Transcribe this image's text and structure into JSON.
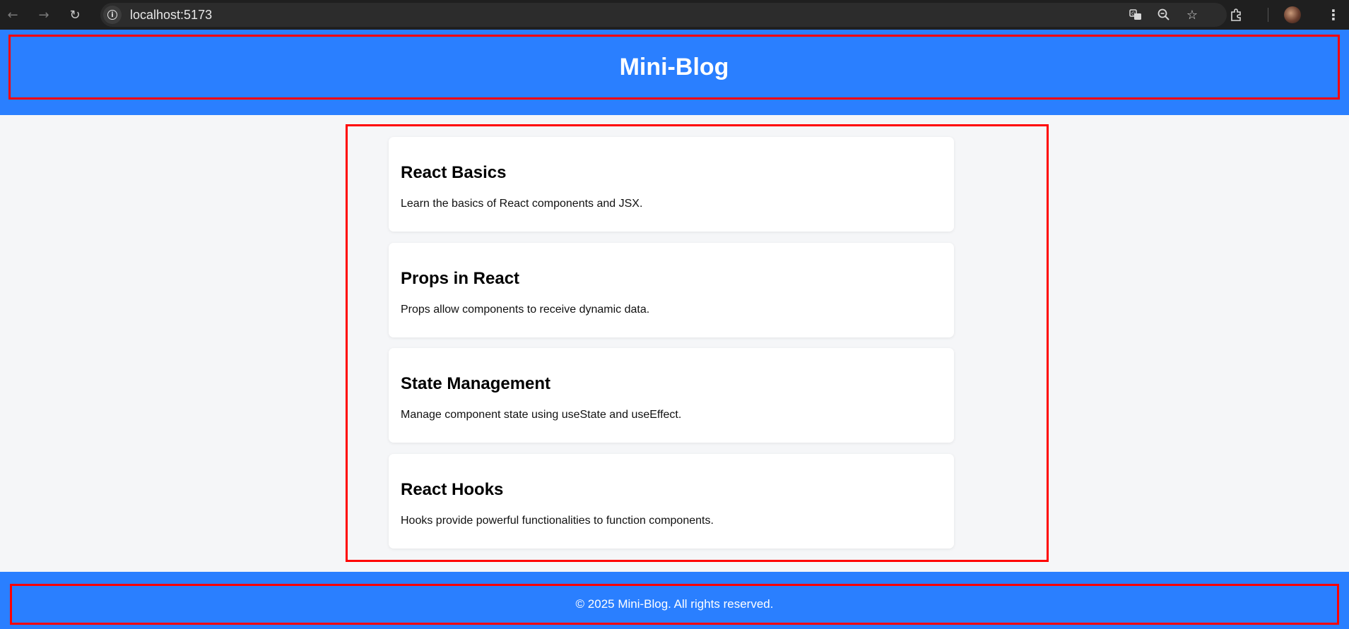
{
  "browser": {
    "url": "localhost:5173",
    "icons": {
      "back": "arrow-left-icon",
      "forward": "arrow-right-icon",
      "reload": "reload-icon",
      "site_info": "info-icon",
      "translate": "translate-icon",
      "zoom": "zoom-out-icon",
      "bookmark": "star-icon",
      "extensions": "puzzle-icon",
      "profile": "avatar",
      "menu": "kebab-menu-icon"
    }
  },
  "header": {
    "title": "Mini-Blog"
  },
  "posts": [
    {
      "title": "React Basics",
      "body": "Learn the basics of React components and JSX."
    },
    {
      "title": "Props in React",
      "body": "Props allow components to receive dynamic data."
    },
    {
      "title": "State Management",
      "body": "Manage component state using useState and useEffect."
    },
    {
      "title": "React Hooks",
      "body": "Hooks provide powerful functionalities to function components."
    }
  ],
  "footer": {
    "text": "© 2025 Mini-Blog. All rights reserved."
  },
  "colors": {
    "brand_blue": "#2a7fff",
    "highlight_border": "#ff0000",
    "page_bg": "#f5f6f8",
    "card_bg": "#ffffff"
  }
}
